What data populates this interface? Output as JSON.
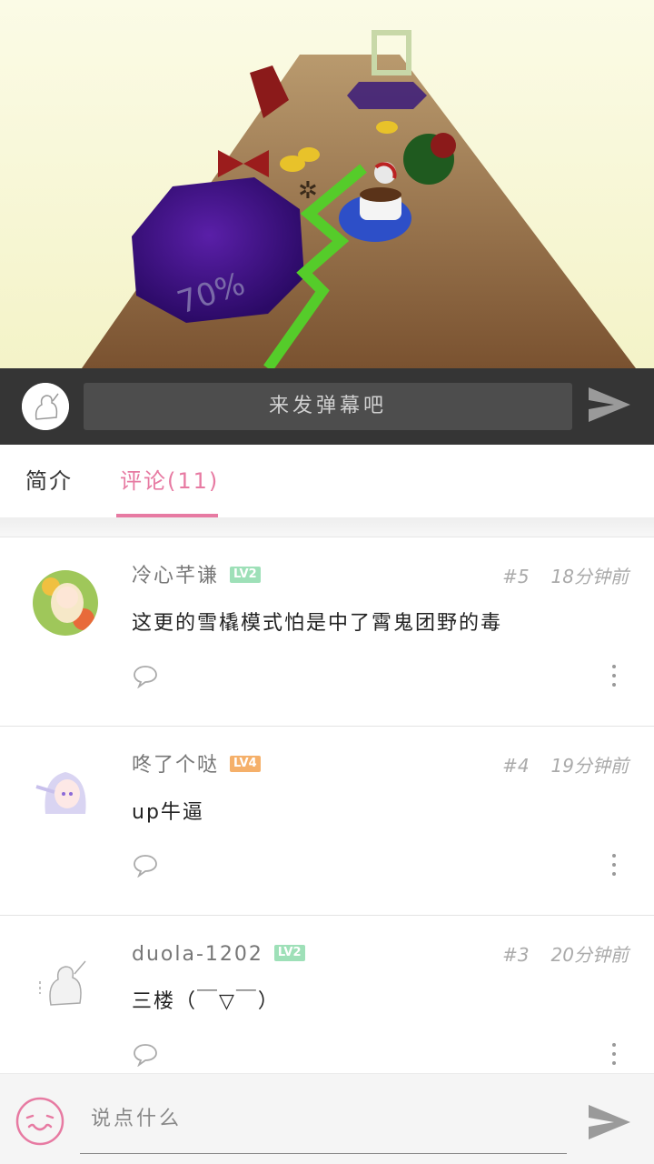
{
  "danmaku": {
    "placeholder": "来发弹幕吧"
  },
  "video": {
    "overlay_text": "70%"
  },
  "tabs": [
    {
      "label": "简介",
      "active": false
    },
    {
      "label": "评论(11)",
      "active": true
    }
  ],
  "colors": {
    "accent": "#e77aa2",
    "danmaku_bar": "#353535",
    "level2": "#9ee0b8",
    "level4": "#f5b06a"
  },
  "comments": [
    {
      "username": "冷心芊谦",
      "level": "LV2",
      "floor": "#5",
      "time": "18分钟前",
      "text": "这更的雪橇模式怕是中了霄鬼团野的毒"
    },
    {
      "username": "咚了个哒",
      "level": "LV4",
      "floor": "#4",
      "time": "19分钟前",
      "text": "up牛逼"
    },
    {
      "username": "duola-1202",
      "level": "LV2",
      "floor": "#3",
      "time": "20分钟前",
      "text": "三楼（￣▽￣）"
    }
  ],
  "comment_box": {
    "placeholder": "说点什么"
  },
  "icons": {
    "send": "send-icon",
    "reply": "speech-bubble-icon",
    "more": "more-vertical-icon",
    "emoji": "emoji-face-icon"
  }
}
